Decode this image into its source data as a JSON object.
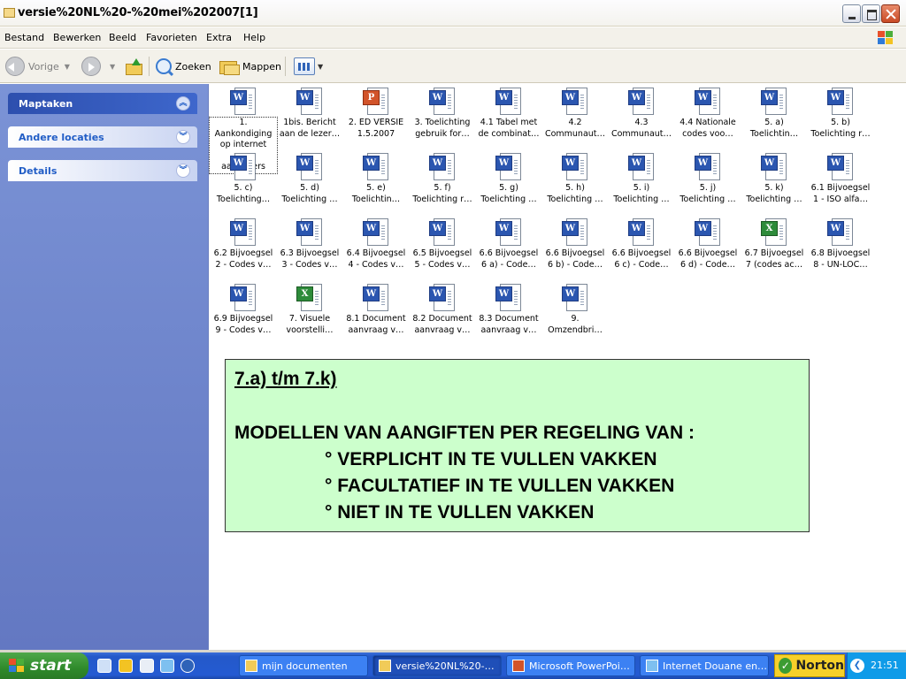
{
  "window": {
    "title": "versie%20NL%20-%20mei%202007[1]"
  },
  "menu": [
    "Bestand",
    "Bewerken",
    "Beeld",
    "Favorieten",
    "Extra",
    "Help"
  ],
  "toolbar": {
    "back": "Vorige",
    "search": "Zoeken",
    "folders": "Mappen"
  },
  "sidebar": {
    "panels": [
      "Maptaken",
      "Andere locaties",
      "Details"
    ]
  },
  "files": [
    {
      "type": "word",
      "name": "1.\nAankondiging\nop internet\nvoor\naangevers",
      "selected": true
    },
    {
      "type": "word",
      "name": "1bis. Bericht\naan de lezer…"
    },
    {
      "type": "ppt",
      "name": "2. ED VERSIE\n1.5.2007"
    },
    {
      "type": "word",
      "name": "3. Toelichting\ngebruik for…"
    },
    {
      "type": "word",
      "name": "4.1 Tabel met\nde combinat…"
    },
    {
      "type": "word",
      "name": "4.2\nCommunaut…"
    },
    {
      "type": "word",
      "name": "4.3\nCommunaut…"
    },
    {
      "type": "word",
      "name": "4.4 Nationale\ncodes voo…"
    },
    {
      "type": "word",
      "name": "5. a)\nToelichtin…"
    },
    {
      "type": "word",
      "name": "5. b)\nToelichting r…"
    },
    {
      "type": "word",
      "name": "5. c)\nToelichting…"
    },
    {
      "type": "word",
      "name": "5. d)\nToelichting …"
    },
    {
      "type": "word",
      "name": "5. e)\nToelichtin…"
    },
    {
      "type": "word",
      "name": "5. f)\nToelichting r…"
    },
    {
      "type": "word",
      "name": "5. g)\nToelichting …"
    },
    {
      "type": "word",
      "name": "5. h)\nToelichting …"
    },
    {
      "type": "word",
      "name": "5. i)\nToelichting …"
    },
    {
      "type": "word",
      "name": "5. j)\nToelichting …"
    },
    {
      "type": "word",
      "name": "5. k)\nToelichting …"
    },
    {
      "type": "word",
      "name": "6.1 Bijvoegsel\n1 - ISO alfa…"
    },
    {
      "type": "word",
      "name": "6.2 Bijvoegsel\n2 - Codes v…"
    },
    {
      "type": "word",
      "name": "6.3 Bijvoegsel\n3 - Codes v…"
    },
    {
      "type": "word",
      "name": "6.4 Bijvoegsel\n4 - Codes v…"
    },
    {
      "type": "word",
      "name": "6.5 Bijvoegsel\n5 - Codes v…"
    },
    {
      "type": "word",
      "name": "6.6 Bijvoegsel\n6 a) - Code…"
    },
    {
      "type": "word",
      "name": "6.6 Bijvoegsel\n6 b) - Code…"
    },
    {
      "type": "word",
      "name": "6.6 Bijvoegsel\n6 c) - Code…"
    },
    {
      "type": "word",
      "name": "6.6 Bijvoegsel\n6 d) - Code…"
    },
    {
      "type": "xls",
      "name": "6.7 Bijvoegsel\n7 (codes ac…"
    },
    {
      "type": "word",
      "name": "6.8 Bijvoegsel\n8 - UN-LOC…"
    },
    {
      "type": "word",
      "name": "6.9 Bijvoegsel\n9 - Codes v…"
    },
    {
      "type": "xls",
      "name": "7. Visuele\nvoorstelli…"
    },
    {
      "type": "word",
      "name": "8.1 Document\naanvraag v…"
    },
    {
      "type": "word",
      "name": "8.2 Document\naanvraag v…"
    },
    {
      "type": "word",
      "name": "8.3 Document\naanvraag v…"
    },
    {
      "type": "word",
      "name": "9.\nOmzendbri…"
    }
  ],
  "callout": {
    "heading": "7.a) t/m 7.k)",
    "main": "MODELLEN VAN AANGIFTEN PER REGELING VAN :",
    "items": [
      "° VERPLICHT IN TE VULLEN VAKKEN",
      "° FACULTATIEF IN TE VULLEN VAKKEN",
      "° NIET IN TE VULLEN VAKKEN"
    ]
  },
  "taskbar": {
    "start": "start",
    "tasks": [
      "mijn documenten",
      "versie%20NL%20-…",
      "Microsoft PowerPoi…",
      "Internet Douane en…"
    ],
    "norton": "Norton",
    "clock": "21:51"
  },
  "colors": {
    "callout_bg": "#ccffcc",
    "sidebar": "#7b93d6",
    "taskbar": "#245ad2",
    "start": "#2f8a2b"
  }
}
